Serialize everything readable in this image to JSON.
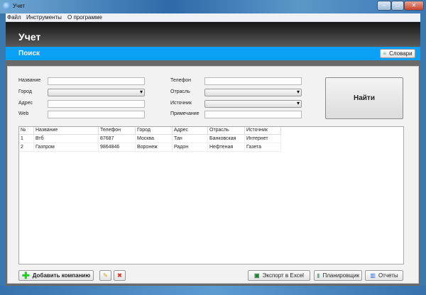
{
  "window": {
    "title": "Учет"
  },
  "menu": [
    "Файл",
    "Инструменты",
    "О программе"
  ],
  "header": {
    "title": "Учет"
  },
  "search_bar": {
    "title": "Поиск",
    "dictionaries_label": "Словари"
  },
  "form": {
    "name_label": "Название",
    "name_value": "",
    "city_label": "Город",
    "city_value": "",
    "address_label": "Адрес",
    "address_value": "",
    "web_label": "Web",
    "web_value": "",
    "phone_label": "Телефон",
    "phone_value": "",
    "industry_label": "Отрасль",
    "industry_value": "",
    "source_label": "Источник",
    "source_value": "",
    "note_label": "Примечание",
    "note_value": "",
    "find_label": "Найти"
  },
  "table": {
    "columns": [
      "№",
      "Название",
      "Телефон",
      "Город",
      "Адрес",
      "Отрасль",
      "Источник"
    ],
    "rows": [
      [
        "1",
        "Втб",
        "87687",
        "Москва",
        "Тан",
        "Банковская",
        "Интернет"
      ],
      [
        "2",
        "Газпром",
        "9864846",
        "Воронеж",
        "Радон",
        "Нефтеная",
        "Газета"
      ]
    ]
  },
  "footer": {
    "add_label": "Добавить компанию",
    "export_label": "Экспорт в Excel",
    "planner_label": "Планировщик",
    "reports_label": "Отчеты"
  }
}
